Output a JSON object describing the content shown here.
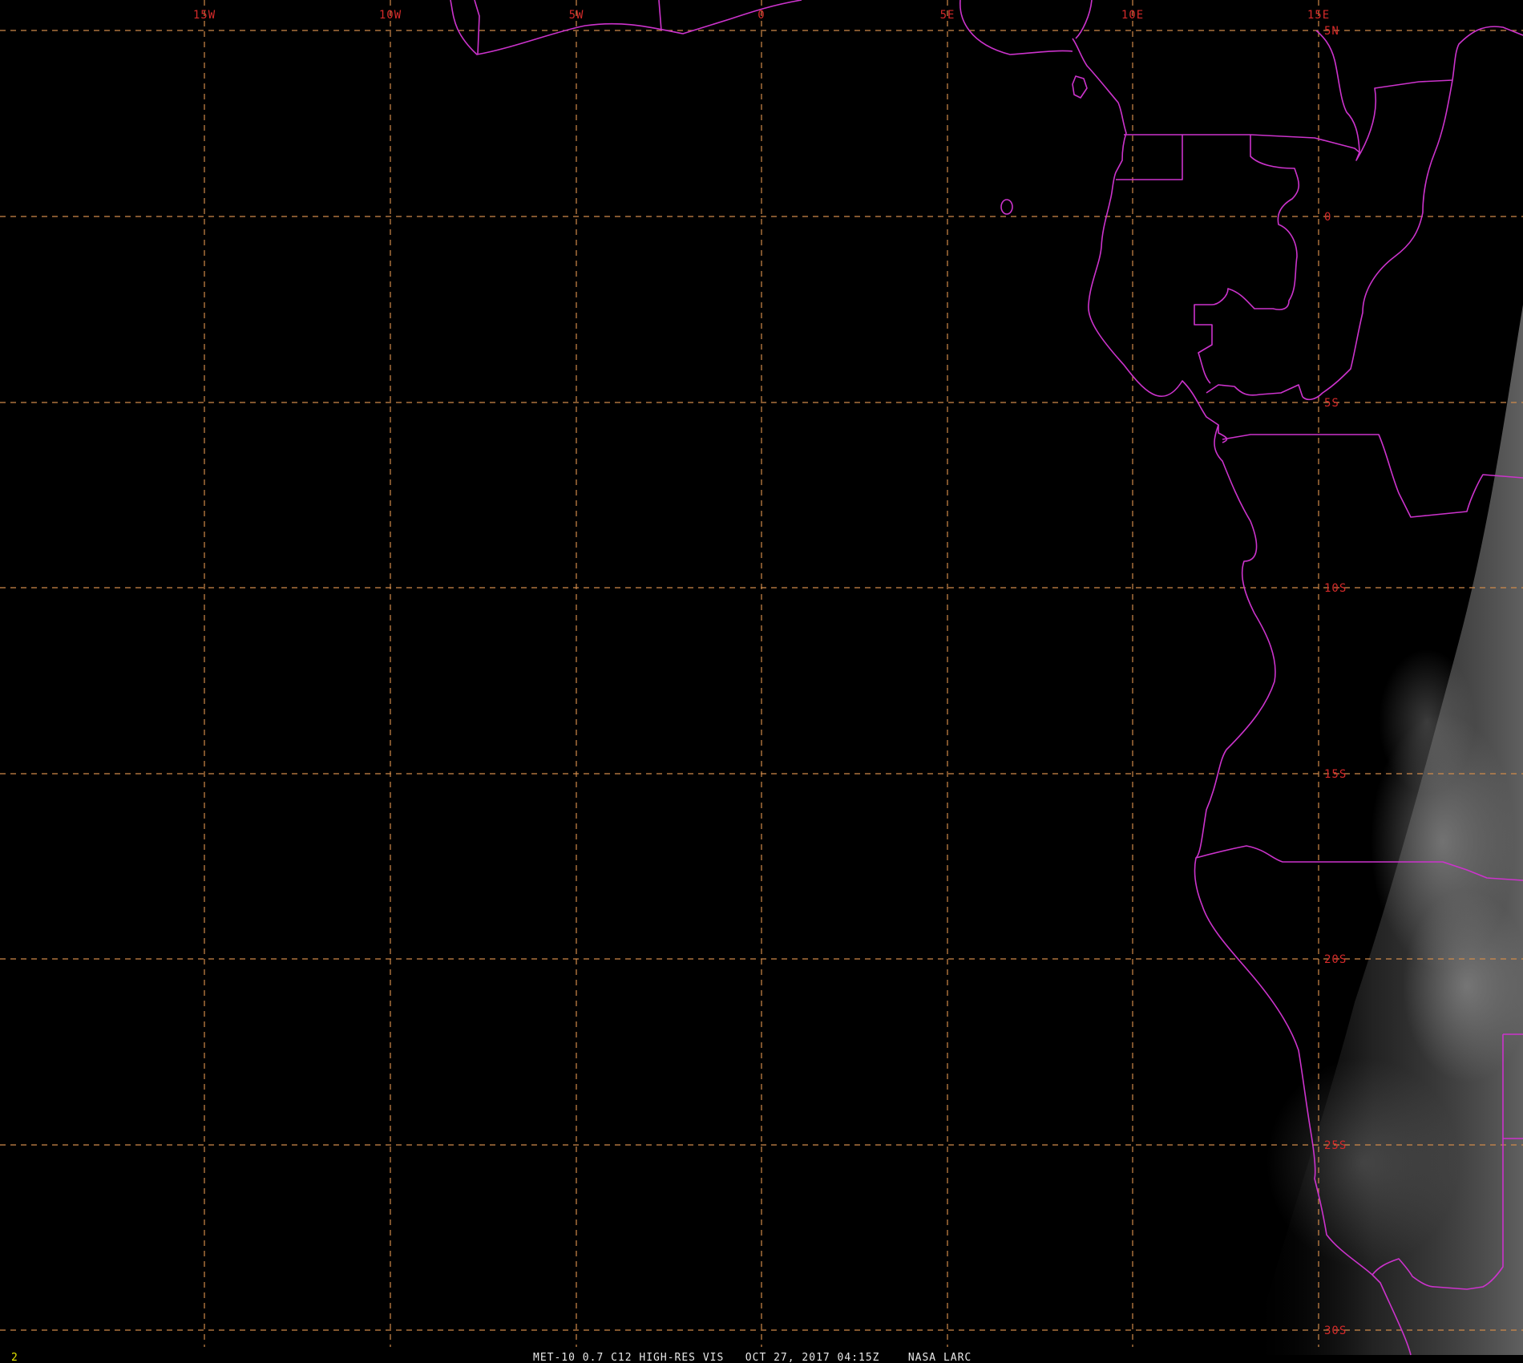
{
  "map": {
    "lon_labels": [
      "15W",
      "10W",
      "5W",
      "0",
      "5E",
      "10E",
      "15E"
    ],
    "lat_labels": [
      "5N",
      "0",
      "5S",
      "10S",
      "15S",
      "20S",
      "25S",
      "30S"
    ],
    "colors": {
      "background": "#000000",
      "grid": "#d08a4a",
      "labels": "#d42a2a",
      "borders": "#cc33cc",
      "caption": "#e8e8e8",
      "frame_number": "#e6e600"
    }
  },
  "caption": {
    "text": "MET-10 0.7 C12 HIGH-RES VIS   OCT 27, 2017 04:15Z    NASA LARC"
  },
  "frame_number": "2"
}
